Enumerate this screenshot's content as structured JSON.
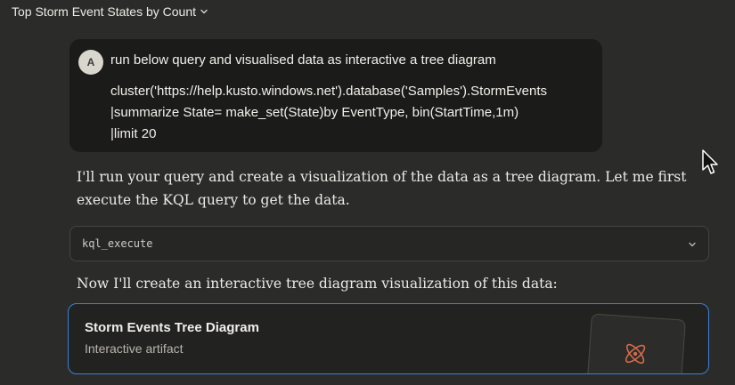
{
  "header": {
    "title": "Top Storm Event States by Count"
  },
  "user_message": {
    "avatar_initial": "A",
    "prompt": "run below query and visualised data as interactive a tree diagram",
    "query_lines": [
      "cluster('https://help.kusto.windows.net').database('Samples').StormEvents",
      "|summarize State= make_set(State)by EventType, bin(StartTime,1m)",
      "|limit 20"
    ]
  },
  "assistant": {
    "intro": "I'll run your query and create a visualization of the data as a tree diagram. Let me first execute the KQL query to get the data.",
    "tool_call": {
      "name": "kql_execute"
    },
    "follow_up": "Now I'll create an interactive tree diagram visualization of this data:",
    "artifact": {
      "title": "Storm Events Tree Diagram",
      "subtitle": "Interactive artifact",
      "icon": "atom-icon"
    }
  },
  "colors": {
    "background": "#2b2b29",
    "user_bubble": "#1b1b1a",
    "artifact_border": "#3b82d9",
    "icon_accent": "#d46b4a"
  }
}
